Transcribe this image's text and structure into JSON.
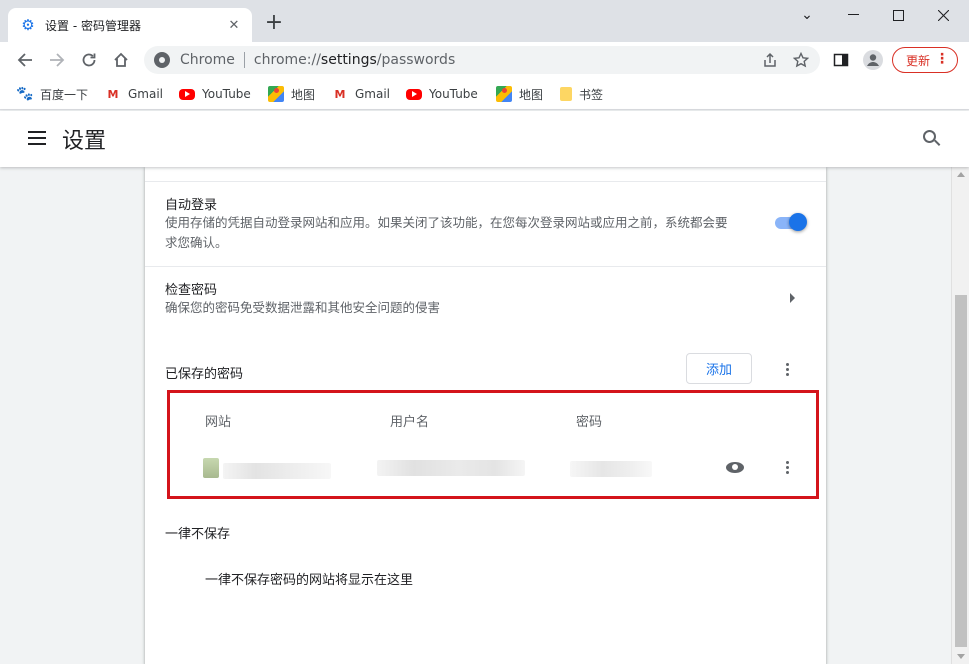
{
  "window": {
    "tab_title": "设置 - 密码管理器",
    "minimize_glyph": "—",
    "maximize_glyph": "☐",
    "close_glyph": "✕",
    "restore_glyph": "⌄",
    "newtab_glyph": "+",
    "tab_close_glyph": "✕"
  },
  "toolbar": {
    "omnibox_chip": "Chrome",
    "url_scheme": "chrome://",
    "url_host": "settings",
    "url_path": "/passwords",
    "update_label": "更新"
  },
  "bookmarks": [
    {
      "label": "百度一下",
      "icon": "baidu-icon"
    },
    {
      "label": "Gmail",
      "icon": "gmail-icon"
    },
    {
      "label": "YouTube",
      "icon": "youtube-icon"
    },
    {
      "label": "地图",
      "icon": "maps-icon"
    },
    {
      "label": "Gmail",
      "icon": "gmail-icon"
    },
    {
      "label": "YouTube",
      "icon": "youtube-icon"
    },
    {
      "label": "地图",
      "icon": "maps-icon"
    },
    {
      "label": "书签",
      "icon": "folder-icon"
    }
  ],
  "settings": {
    "title": "设置",
    "auto_signin": {
      "label": "自动登录",
      "description_line1": "使用存储的凭据自动登录网站和应用。如果关闭了该功能，在您每次登录网站或应用之前，系统都会要",
      "description_line2": "求您确认。",
      "enabled": true
    },
    "check_passwords": {
      "label": "检查密码",
      "description": "确保您的密码免受数据泄露和其他安全问题的侵害"
    },
    "saved_passwords": {
      "heading": "已保存的密码",
      "add_label": "添加",
      "columns": [
        "网站",
        "用户名",
        "密码"
      ]
    },
    "never_saved": {
      "heading": "一律不保存",
      "empty_message": "一律不保存密码的网站将显示在这里"
    }
  },
  "colors": {
    "accent": "#1a73e8",
    "highlight_box": "#d4141b",
    "update_red": "#d93025"
  }
}
